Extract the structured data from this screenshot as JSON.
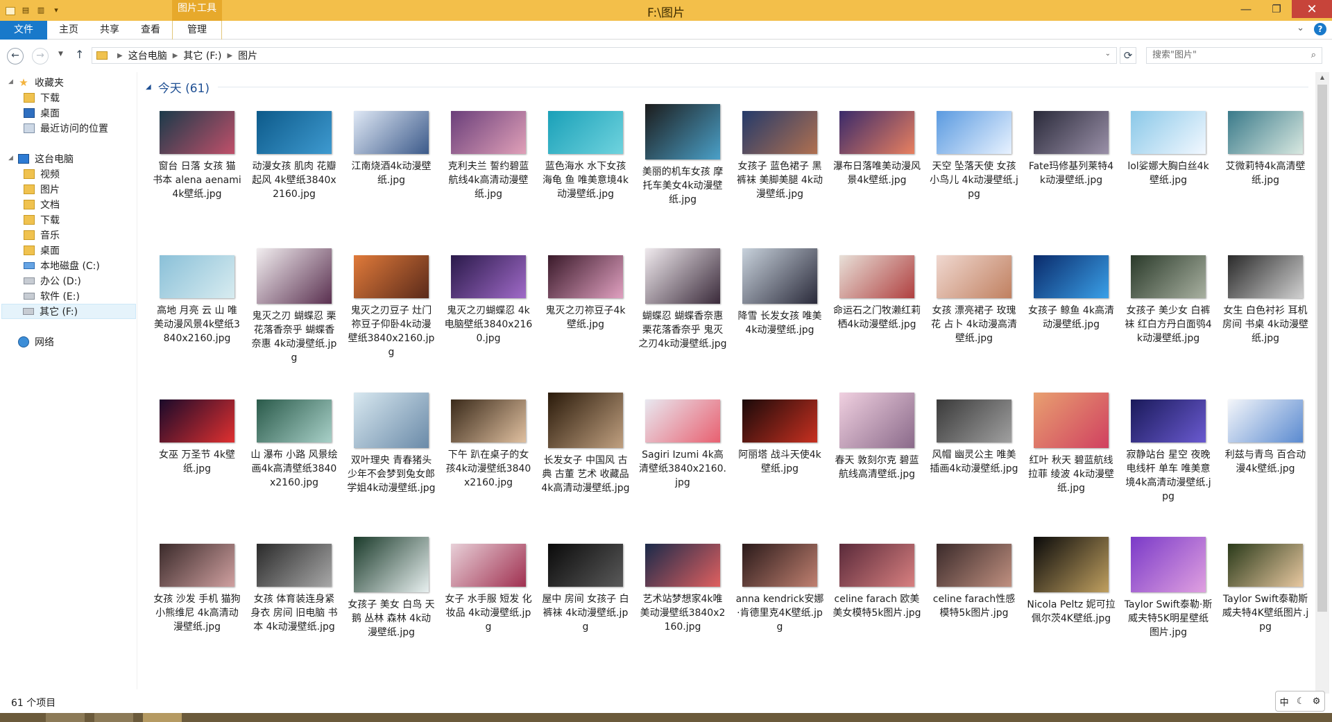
{
  "window": {
    "title": "F:\\图片",
    "context_tab": "图片工具"
  },
  "ribbon": {
    "tabs": [
      "文件",
      "主页",
      "共享",
      "查看",
      "管理"
    ]
  },
  "address": {
    "crumbs": [
      "这台电脑",
      "其它 (F:)",
      "图片"
    ],
    "search_placeholder": "搜索\"图片\""
  },
  "sidebar": {
    "favorites_label": "收藏夹",
    "favorites": [
      {
        "label": "下载",
        "icon": "download-folder-icon"
      },
      {
        "label": "桌面",
        "icon": "desktop-icon"
      },
      {
        "label": "最近访问的位置",
        "icon": "recent-places-icon"
      }
    ],
    "pc_label": "这台电脑",
    "pc_items": [
      {
        "label": "视频",
        "icon": "videos-folder-icon"
      },
      {
        "label": "图片",
        "icon": "pictures-folder-icon"
      },
      {
        "label": "文档",
        "icon": "documents-folder-icon"
      },
      {
        "label": "下载",
        "icon": "download-folder-icon"
      },
      {
        "label": "音乐",
        "icon": "music-folder-icon"
      },
      {
        "label": "桌面",
        "icon": "desktop-folder-icon"
      },
      {
        "label": "本地磁盘 (C:)",
        "icon": "system-drive-icon"
      },
      {
        "label": "办公 (D:)",
        "icon": "drive-icon"
      },
      {
        "label": "软件 (E:)",
        "icon": "drive-icon"
      },
      {
        "label": "其它 (F:)",
        "icon": "drive-icon"
      }
    ],
    "network_label": "网络"
  },
  "group": {
    "label": "今天 (61)"
  },
  "files": [
    {
      "name": "窗台 日落 女孩 猫 书本 alena aenami 4k壁纸.jpg",
      "colors": [
        "#1b3a4a",
        "#c0506a"
      ]
    },
    {
      "name": "动漫女孩 肌肉 花瓣 起风 4k壁纸3840x2160.jpg",
      "colors": [
        "#0d5a8a",
        "#3e9ad0"
      ]
    },
    {
      "name": "江南烧酒4k动漫壁纸.jpg",
      "colors": [
        "#dfe8f5",
        "#3c5a8a"
      ]
    },
    {
      "name": "克利夫兰 誓约碧蓝航线4k高清动漫壁纸.jpg",
      "colors": [
        "#6a3f7a",
        "#e0a0b8"
      ]
    },
    {
      "name": "蓝色海水 水下女孩 海龟 鱼 唯美意境4k动漫壁纸.jpg",
      "colors": [
        "#1aa0b8",
        "#6fd3de"
      ]
    },
    {
      "name": "美丽的机车女孩 摩托车美女4k动漫壁纸.jpg",
      "colors": [
        "#1c1c1c",
        "#4aa0c8"
      ],
      "tall": true
    },
    {
      "name": "女孩子 蓝色裙子 黑裤袜 美脚美腿 4k动漫壁纸.jpg",
      "colors": [
        "#243a6a",
        "#b07050"
      ]
    },
    {
      "name": "瀑布日落唯美动漫风景4k壁纸.jpg",
      "colors": [
        "#3a2a6a",
        "#e88060"
      ]
    },
    {
      "name": "天空 坠落天使 女孩 小鸟儿 4k动漫壁纸.jpg",
      "colors": [
        "#5a9ae0",
        "#e8f2ff"
      ]
    },
    {
      "name": "Fate玛修基列莱特4k动漫壁纸.jpg",
      "colors": [
        "#2a2a3a",
        "#9a90a8"
      ]
    },
    {
      "name": "lol娑娜大胸白丝4k壁纸.jpg",
      "colors": [
        "#8ac8e8",
        "#f2f8ff"
      ]
    },
    {
      "name": "艾微莉特4k高清壁纸.jpg",
      "colors": [
        "#3a7a8a",
        "#d8e8e0"
      ]
    },
    {
      "name": "高地 月亮 云 山 唯美动漫风景4k壁纸3840x2160.jpg",
      "colors": [
        "#8ac0d8",
        "#d8ecf0"
      ]
    },
    {
      "name": "鬼灭之刃 蝴蝶忍 栗花落香奈乎 蝴蝶香奈惠 4k动漫壁纸.jpg",
      "colors": [
        "#f2eef0",
        "#5a3050"
      ],
      "tall": true
    },
    {
      "name": "鬼灭之刃豆子 灶门祢豆子仰卧4k动漫壁纸3840x2160.jpg",
      "colors": [
        "#e07a3a",
        "#5a2a1a"
      ]
    },
    {
      "name": "鬼灭之刃蝴蝶忍 4k电脑壁纸3840x2160.jpg",
      "colors": [
        "#2a1a4a",
        "#a06ac8"
      ]
    },
    {
      "name": "鬼灭之刃祢豆子4k壁纸.jpg",
      "colors": [
        "#3a1a2a",
        "#e0a0c0"
      ]
    },
    {
      "name": "蝴蝶忍 蝴蝶香奈惠 栗花落香奈乎 鬼灭之刃4k动漫壁纸.jpg",
      "colors": [
        "#f0eaee",
        "#3a2a3a"
      ],
      "tall": true
    },
    {
      "name": "降雪 长发女孩 唯美4k动漫壁纸.jpg",
      "colors": [
        "#c8d2dc",
        "#2a2a3a"
      ],
      "tall": true
    },
    {
      "name": "命运石之门牧濑红莉栖4k动漫壁纸.jpg",
      "colors": [
        "#e8e0d8",
        "#b04040"
      ]
    },
    {
      "name": "女孩 漂亮裙子 玫瑰花 占卜 4k动漫高清壁纸.jpg",
      "colors": [
        "#f0d8d0",
        "#c08060"
      ]
    },
    {
      "name": "女孩子 鲸鱼 4k高清动漫壁纸.jpg",
      "colors": [
        "#0a2a6a",
        "#3aa0e8"
      ]
    },
    {
      "name": "女孩子 美少女 白裤袜 红白方丹白面鸮4k动漫壁纸.jpg",
      "colors": [
        "#2a3a2a",
        "#a8b0a0"
      ]
    },
    {
      "name": "女生 白色衬衫 耳机 房间 书桌 4k动漫壁纸.jpg",
      "colors": [
        "#2a2a2a",
        "#d0d0d0"
      ]
    },
    {
      "name": "女巫 万圣节 4k壁纸.jpg",
      "colors": [
        "#1a0a2a",
        "#e03030"
      ]
    },
    {
      "name": "山 瀑布 小路 风景绘画4k高清壁纸3840x2160.jpg",
      "colors": [
        "#2a5a4a",
        "#a8d0c8"
      ]
    },
    {
      "name": "双叶理央 青春猪头少年不会梦到兔女郎学姐4k动漫壁纸.jpg",
      "colors": [
        "#d8e8f0",
        "#6a8aa8"
      ],
      "tall": true
    },
    {
      "name": "下午 趴在桌子的女孩4k动漫壁纸3840x2160.jpg",
      "colors": [
        "#3a2a1a",
        "#e0c0a0"
      ]
    },
    {
      "name": "长发女子 中国风 古典 古董 艺术 收藏品 4k高清动漫壁纸.jpg",
      "colors": [
        "#2a1a0a",
        "#c0a080"
      ],
      "tall": true
    },
    {
      "name": "Sagiri Izumi 4k高清壁纸3840x2160.jpg",
      "colors": [
        "#e8e8f0",
        "#e86070"
      ]
    },
    {
      "name": "阿丽塔 战斗天使4k壁纸.jpg",
      "colors": [
        "#1a0a0a",
        "#c83020"
      ]
    },
    {
      "name": "春天 敦刻尔克 碧蓝航线高清壁纸.jpg",
      "colors": [
        "#f0d0e0",
        "#8a6a8a"
      ],
      "tall": true
    },
    {
      "name": "风帽 幽灵公主 唯美插画4k动漫壁纸.jpg",
      "colors": [
        "#3a3a3a",
        "#a0a0a0"
      ]
    },
    {
      "name": "红叶 秋天 碧蓝航线拉菲 绫波 4k动漫壁纸.jpg",
      "colors": [
        "#e8a070",
        "#d04060"
      ],
      "tall": true
    },
    {
      "name": "寂静站台 星空 夜晚 电线杆 单车 唯美意境4k高清动漫壁纸.jpg",
      "colors": [
        "#1a1a5a",
        "#6a5ad0"
      ]
    },
    {
      "name": "利兹与青鸟 百合动漫4k壁纸.jpg",
      "colors": [
        "#f4f6fa",
        "#5a8ad0"
      ]
    },
    {
      "name": "女孩 沙发 手机 猫狗 小熊维尼 4k高清动漫壁纸.jpg",
      "colors": [
        "#3a2a2a",
        "#d0a0a0"
      ]
    },
    {
      "name": "女孩 体育装连身紧身衣 房间 旧电脑 书本 4k动漫壁纸.jpg",
      "colors": [
        "#2a2a2a",
        "#a8a8a8"
      ]
    },
    {
      "name": "女孩子 美女 白鸟 天鹅 丛林 森林 4k动漫壁纸.jpg",
      "colors": [
        "#1a3a2a",
        "#e8f0f0"
      ],
      "tall": true
    },
    {
      "name": "女子 水手服 短发 化妆品 4k动漫壁纸.jpg",
      "colors": [
        "#e8d0d8",
        "#a03050"
      ]
    },
    {
      "name": "屋中 房间 女孩子 白裤袜 4k动漫壁纸.jpg",
      "colors": [
        "#0a0a0a",
        "#5a5a5a"
      ]
    },
    {
      "name": "艺术站梦想家4k唯美动漫壁纸3840x2160.jpg",
      "colors": [
        "#1a2a4a",
        "#e06060"
      ]
    },
    {
      "name": "anna kendrick安娜·肯德里克4K壁纸.jpg",
      "colors": [
        "#2a1a1a",
        "#c08070"
      ]
    },
    {
      "name": "celine farach 欧美美女模特5k图片.jpg",
      "colors": [
        "#5a2a3a",
        "#d88080"
      ]
    },
    {
      "name": "celine farach性感模特5k图片.jpg",
      "colors": [
        "#3a2a2a",
        "#c09080"
      ]
    },
    {
      "name": "Nicola Peltz 妮可拉佩尔茨4K壁纸.jpg",
      "colors": [
        "#0a0a0a",
        "#c0a060"
      ],
      "tall": true
    },
    {
      "name": "Taylor Swift泰勒·斯威夫特5K明星壁纸图片.jpg",
      "colors": [
        "#7a3ac8",
        "#e0a0e0"
      ],
      "tall": true
    },
    {
      "name": "Taylor Swift泰勒斯威夫特4K壁纸图片.jpg",
      "colors": [
        "#2a3a1a",
        "#e8c8a0"
      ]
    }
  ],
  "status": {
    "count": "61 个项目"
  },
  "ime": {
    "mode": "中"
  }
}
